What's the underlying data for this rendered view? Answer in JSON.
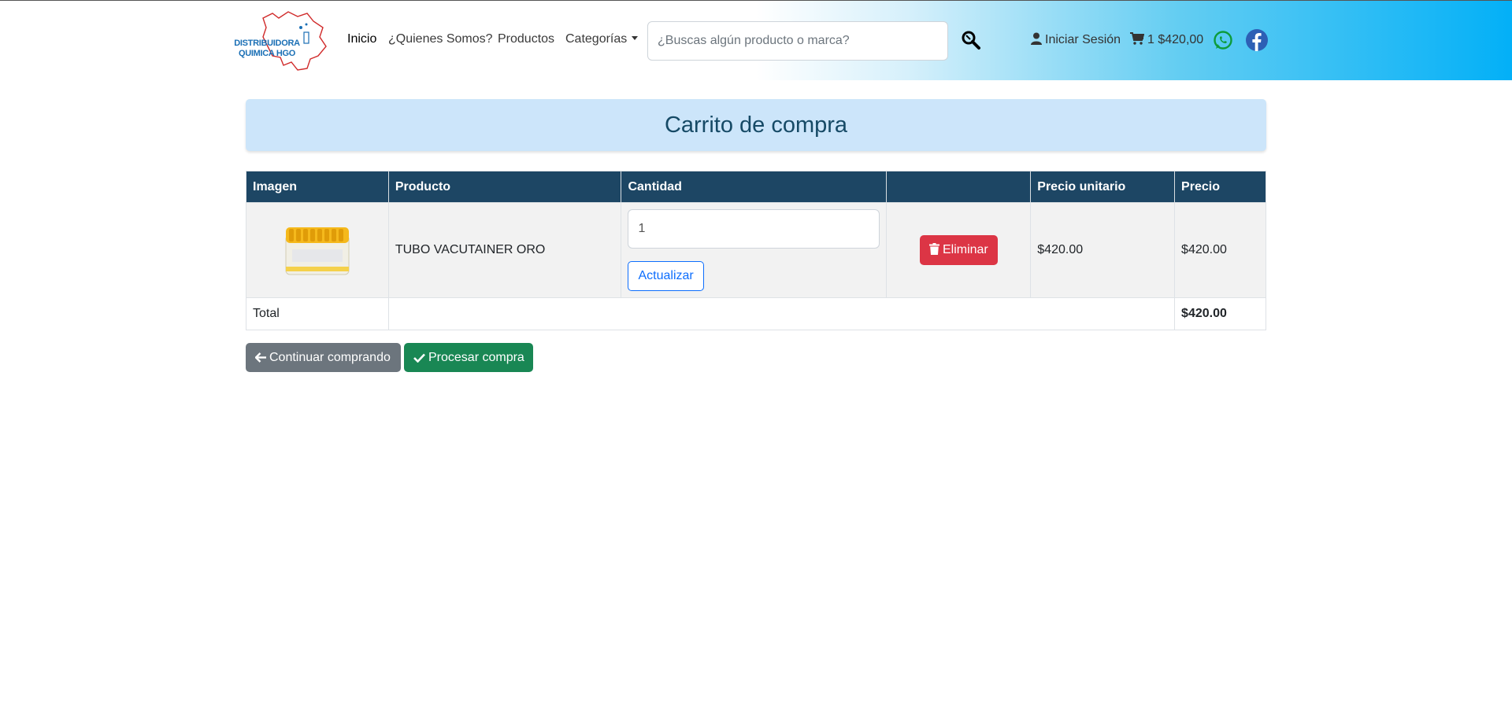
{
  "header": {
    "logo_text": "DISTRIBUIDORA QUIMICA HGO",
    "nav": [
      {
        "label": "Inicio"
      },
      {
        "label": "¿Quienes Somos?"
      },
      {
        "label": "Productos"
      },
      {
        "label": "Categorías"
      }
    ],
    "search_placeholder": "¿Buscas algún producto o marca?",
    "login_label": "Iniciar Sesión",
    "cart_summary": "1 $420,00"
  },
  "page": {
    "title": "Carrito de compra"
  },
  "table": {
    "columns": [
      "Imagen",
      "Producto",
      "Cantidad",
      "",
      "Precio unitario",
      "Precio"
    ],
    "items": [
      {
        "product": "TUBO VACUTAINER ORO",
        "quantity": "1",
        "update_label": "Actualizar",
        "delete_label": "Eliminar",
        "unit_price": "$420.00",
        "price": "$420.00"
      }
    ],
    "total_label": "Total",
    "total_value": "$420.00"
  },
  "actions": {
    "continue_label": "Continuar comprando",
    "process_label": "Procesar compra"
  },
  "colors": {
    "header_blue": "#1d4664",
    "title_bg": "#cce5fa",
    "danger": "#dc3545",
    "success": "#198754",
    "secondary": "#6c757d",
    "primary": "#0d6efd"
  }
}
